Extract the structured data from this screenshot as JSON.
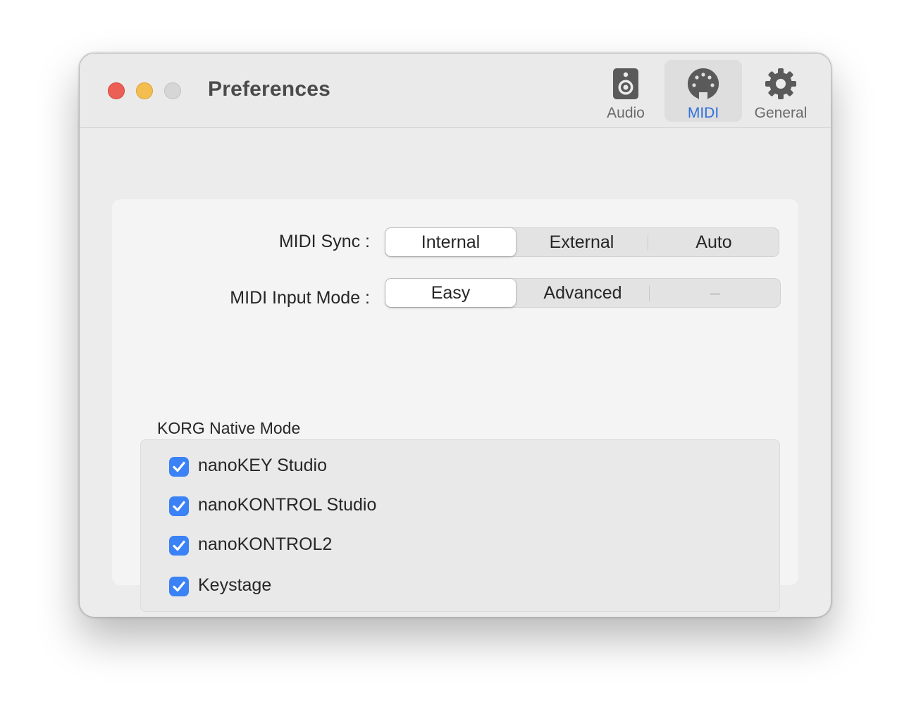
{
  "window": {
    "title": "Preferences"
  },
  "toolbar": {
    "items": [
      {
        "label": "Audio",
        "icon": "speaker-icon",
        "selected": false
      },
      {
        "label": "MIDI",
        "icon": "midi-port-icon",
        "selected": true
      },
      {
        "label": "General",
        "icon": "gear-icon",
        "selected": false
      }
    ]
  },
  "midi_sync": {
    "label": "MIDI Sync :",
    "options": [
      "Internal",
      "External",
      "Auto"
    ],
    "selected": "Internal"
  },
  "midi_input_mode": {
    "label": "MIDI Input Mode :",
    "options": [
      "Easy",
      "Advanced",
      "–"
    ],
    "selected": "Easy"
  },
  "korg_native_mode": {
    "title": "KORG Native Mode",
    "items": [
      {
        "label": "nanoKEY Studio",
        "checked": true
      },
      {
        "label": "nanoKONTROL Studio",
        "checked": true
      },
      {
        "label": "nanoKONTROL2",
        "checked": true
      },
      {
        "label": "Keystage",
        "checked": true
      }
    ]
  },
  "colors": {
    "accent": "#2f6fde",
    "checkbox": "#3a82f6",
    "close": "#ec5f57",
    "minimize": "#f4bd4f",
    "zoom_inactive": "#d6d6d6"
  }
}
